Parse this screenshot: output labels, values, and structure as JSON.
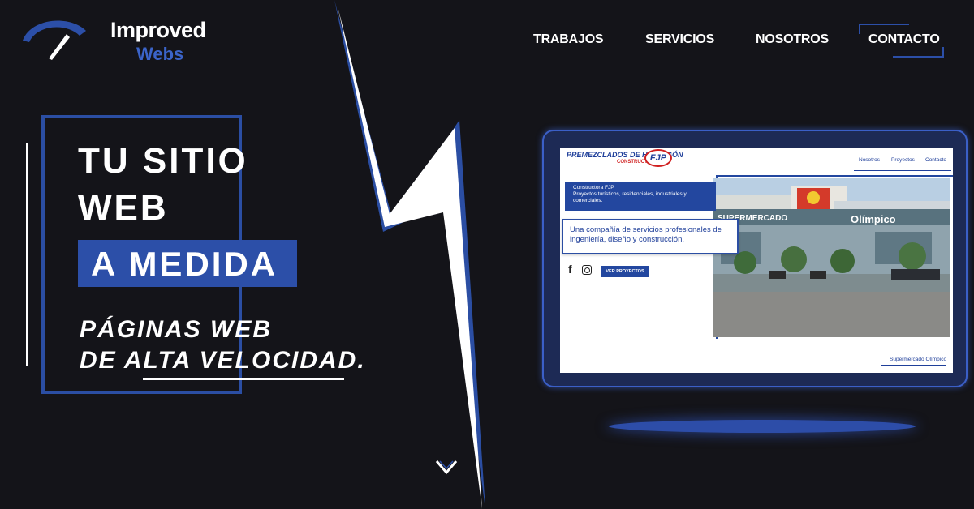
{
  "brand": {
    "name_line1": "Improved",
    "name_line2": "Webs",
    "accent": "#2c4fa8"
  },
  "nav": {
    "items": [
      {
        "label": "TRABAJOS"
      },
      {
        "label": "SERVICIOS"
      },
      {
        "label": "NOSOTROS"
      },
      {
        "label": "CONTACTO"
      }
    ]
  },
  "hero": {
    "title_line1": "TU SITIO",
    "title_line2": "WEB",
    "badge": "A MEDIDA",
    "subtitle_line1": "PÁGINAS WEB",
    "subtitle_line2": "DE ALTA VELOCIDAD.",
    "scroll_icon": "chevron-down-icon"
  },
  "preview": {
    "logo_text": "PREMEZCLADOS DE HORMIGÓN",
    "logo_sub": "CONSTRUCTORA",
    "logo_mark": "FJP",
    "nav": [
      "Nosotros",
      "Proyectos",
      "Contacto"
    ],
    "card_title": "Constructora FJP",
    "card_body": "Proyectos turísticos, residenciales, industriales y comerciales.",
    "highlight": "Una compañía de servicios profesionales de ingeniería, diseño y construcción.",
    "button": "VER PROYECTOS",
    "photo_sign_left": "SUPERMERCADO",
    "photo_sign_right": "Olímpico",
    "caption": "Supermercado Olímpico"
  }
}
